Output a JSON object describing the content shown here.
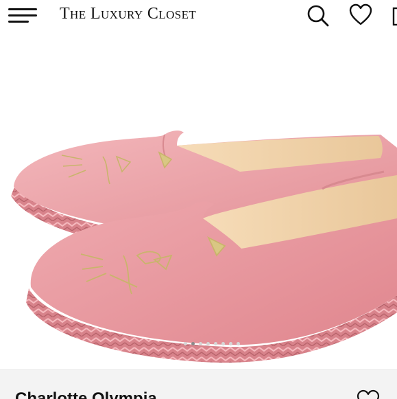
{
  "header": {
    "brand": "The Luxury Closet",
    "menu_icon": "hamburger-menu-icon",
    "search_icon": "search-icon",
    "wishlist_icon": "heart-icon"
  },
  "gallery": {
    "image_alt": "Pink leather cat-embroidered espadrille flats",
    "image_count": 8,
    "active_index": 1
  },
  "product": {
    "name": "Charlotte Olympia",
    "wishlist_icon": "heart-outline-icon"
  },
  "colors": {
    "text": "#111111",
    "panel": "#f3f3f3",
    "shoe": "#eaa1a6"
  }
}
